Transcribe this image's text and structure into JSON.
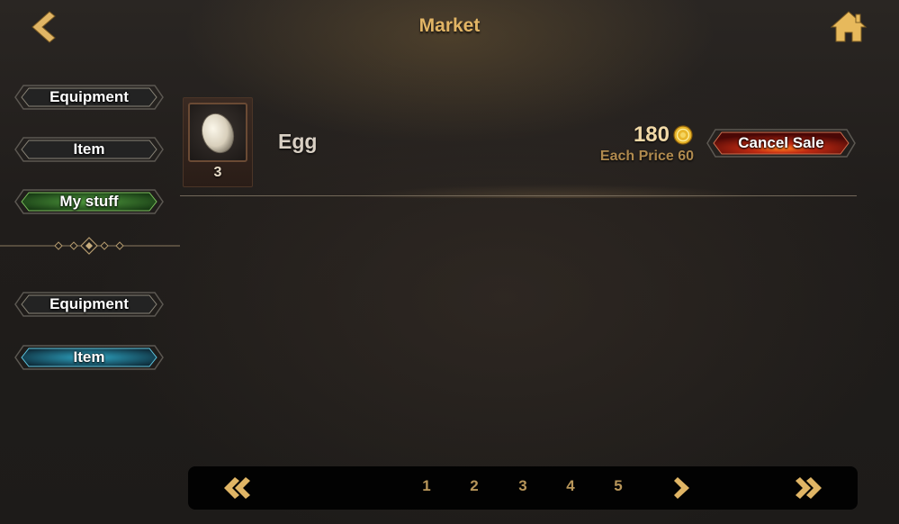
{
  "header": {
    "title": "Market",
    "back_icon": "chevron-left-icon",
    "home_icon": "home-icon"
  },
  "sidebar": {
    "group1": [
      {
        "label": "Equipment",
        "state": "normal"
      },
      {
        "label": "Item",
        "state": "normal"
      },
      {
        "label": "My stuff",
        "state": "selected"
      }
    ],
    "group2": [
      {
        "label": "Equipment",
        "state": "normal"
      },
      {
        "label": "Item",
        "state": "selected"
      }
    ]
  },
  "listings": [
    {
      "name": "Egg",
      "quantity": "3",
      "total_price": "180",
      "each_price": "Each Price 60",
      "icon": "egg-icon",
      "currency_icon": "gold-coin-icon",
      "action_label": "Cancel Sale"
    }
  ],
  "pagination": {
    "pages": [
      "1",
      "2",
      "3",
      "4",
      "5"
    ],
    "first_icon": "double-chevron-left-icon",
    "next_icon": "chevron-right-icon",
    "last_icon": "double-chevron-right-icon"
  },
  "colors": {
    "gold": "#e2b565",
    "tab_dark": "#232323",
    "tab_green": "#2f6b2a",
    "tab_blue": "#1c6b86",
    "cancel_red": "#9a1a10"
  }
}
